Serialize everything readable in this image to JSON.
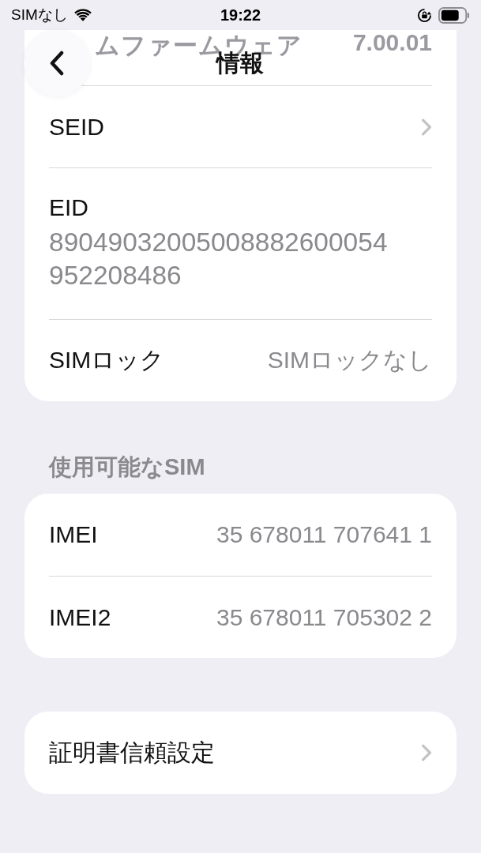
{
  "status_bar": {
    "carrier": "SIMなし",
    "time": "19:22"
  },
  "nav": {
    "title": "情報"
  },
  "groups": [
    {
      "rows": [
        {
          "kind": "faded",
          "label": "ムファームウェア",
          "value": "7.00.01"
        },
        {
          "kind": "link",
          "label": "SEID"
        },
        {
          "kind": "stacked",
          "label": "EID",
          "value": "89049032005008882600054952208486"
        },
        {
          "kind": "value",
          "label": "SIMロック",
          "value": "SIMロックなし"
        }
      ]
    },
    {
      "header": "使用可能なSIM",
      "rows": [
        {
          "kind": "value",
          "label": "IMEI",
          "value": "35 678011 707641 1"
        },
        {
          "kind": "value",
          "label": "IMEI2",
          "value": "35 678011 705302 2"
        }
      ]
    },
    {
      "rows": [
        {
          "kind": "link",
          "label": "証明書信頼設定"
        }
      ]
    }
  ]
}
